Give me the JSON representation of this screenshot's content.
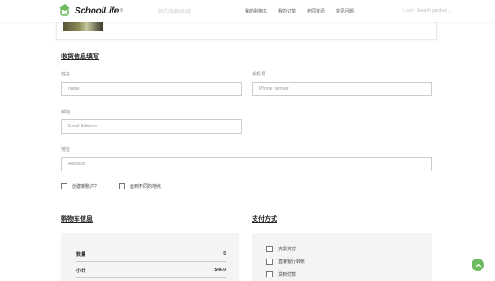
{
  "header": {
    "brand": "SchoolLife",
    "brand_reg": "®",
    "faint_text": "我的购物商城",
    "nav": [
      {
        "label": "我的购物车"
      },
      {
        "label": "我的订单"
      },
      {
        "label": "校园资讯"
      },
      {
        "label": "常见问题"
      }
    ],
    "faint_text_right": "Login",
    "search_placeholder": "Search product ..."
  },
  "shipping": {
    "title": "收货信息填写",
    "name": {
      "label": "姓名",
      "placeholder": "name"
    },
    "phone": {
      "label": "手机号",
      "placeholder": "Phone number"
    },
    "email": {
      "label": "邮箱",
      "placeholder": "Email Address"
    },
    "address": {
      "label": "地址",
      "placeholder": "Address"
    },
    "create_account": "创建新账户?",
    "ship_different": "运到不同的地点"
  },
  "cart": {
    "title": "购物车信息",
    "rows": [
      {
        "label": "数量",
        "value": "5"
      },
      {
        "label": "小计",
        "value": "$44.0"
      }
    ]
  },
  "payment": {
    "title": "支付方式",
    "options": [
      {
        "label": "支票支付"
      },
      {
        "label": "直接银行转账"
      },
      {
        "label": "贷到付款"
      }
    ]
  },
  "colors": {
    "accent_green": "#6dbb5f"
  }
}
